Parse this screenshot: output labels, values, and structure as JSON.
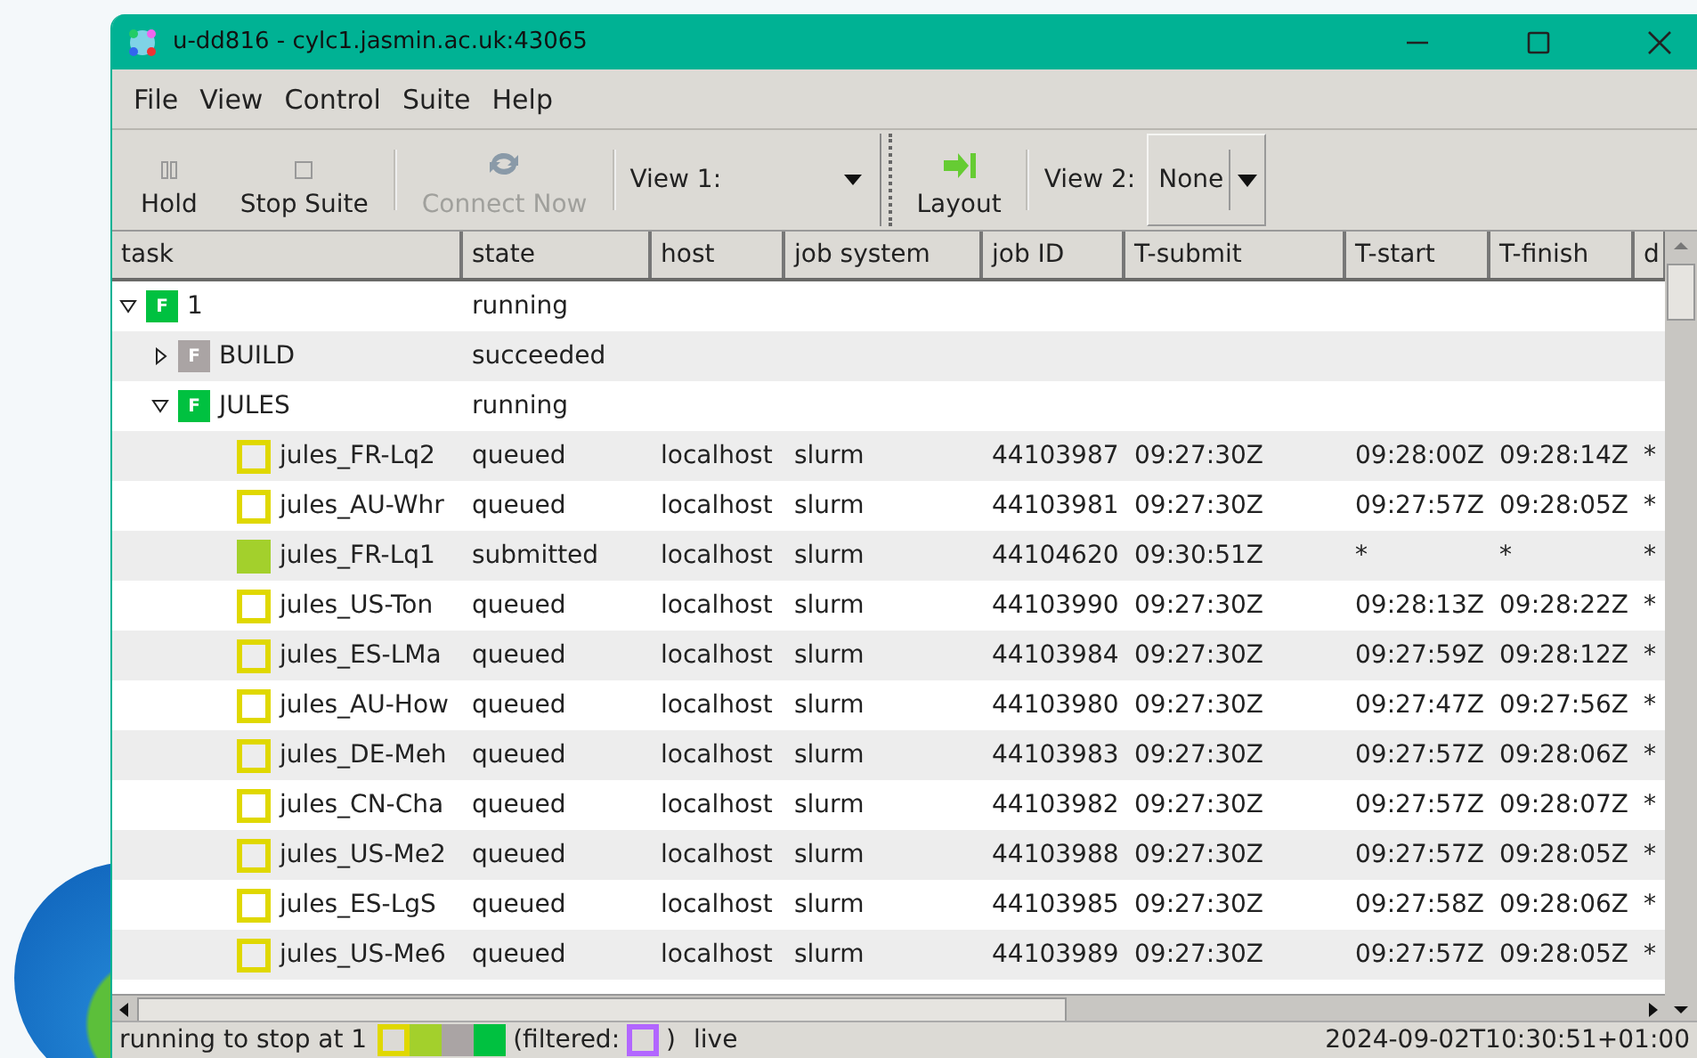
{
  "window": {
    "title": "u-dd816 - cylc1.jasmin.ac.uk:43065"
  },
  "menu": [
    "File",
    "View",
    "Control",
    "Suite",
    "Help"
  ],
  "toolbar": {
    "hold": "Hold",
    "stop": "Stop Suite",
    "connect": "Connect Now",
    "view1_label": "View 1:",
    "layout": "Layout",
    "view2_label": "View 2:",
    "view2_value": "None"
  },
  "table": {
    "columns": [
      "task",
      "state",
      "host",
      "job system",
      "job ID",
      "T-submit",
      "T-start",
      "T-finish",
      "d"
    ],
    "rows": [
      {
        "kind": "family",
        "badge": "F",
        "color": "#00c140",
        "expanded": true,
        "cells": [
          "1",
          "running",
          "",
          "",
          "",
          "",
          "",
          "",
          ""
        ],
        "children": [
          {
            "kind": "family",
            "badge": "F",
            "color": "#aaa4a4",
            "expanded": false,
            "cells": [
              "BUILD",
              "succeeded",
              "",
              "",
              "",
              "",
              "",
              "",
              ""
            ]
          },
          {
            "kind": "family",
            "badge": "F",
            "color": "#00c140",
            "expanded": true,
            "cells": [
              "JULES",
              "running",
              "",
              "",
              "",
              "",
              "",
              "",
              ""
            ],
            "children": [
              {
                "kind": "task",
                "color": "#e0d800",
                "filled": false,
                "cells": [
                  "jules_FR-Lq2",
                  "queued",
                  "localhost",
                  "slurm",
                  "44103987",
                  "09:27:30Z",
                  "09:28:00Z",
                  "09:28:14Z",
                  "*"
                ]
              },
              {
                "kind": "task",
                "color": "#e0d800",
                "filled": false,
                "cells": [
                  "jules_AU-Whr",
                  "queued",
                  "localhost",
                  "slurm",
                  "44103981",
                  "09:27:30Z",
                  "09:27:57Z",
                  "09:28:05Z",
                  "*"
                ]
              },
              {
                "kind": "task",
                "color": "#a3d02c",
                "filled": true,
                "cells": [
                  "jules_FR-Lq1",
                  "submitted",
                  "localhost",
                  "slurm",
                  "44104620",
                  "09:30:51Z",
                  "*",
                  "*",
                  "*"
                ]
              },
              {
                "kind": "task",
                "color": "#e0d800",
                "filled": false,
                "cells": [
                  "jules_US-Ton",
                  "queued",
                  "localhost",
                  "slurm",
                  "44103990",
                  "09:27:30Z",
                  "09:28:13Z",
                  "09:28:22Z",
                  "*"
                ]
              },
              {
                "kind": "task",
                "color": "#e0d800",
                "filled": false,
                "cells": [
                  "jules_ES-LMa",
                  "queued",
                  "localhost",
                  "slurm",
                  "44103984",
                  "09:27:30Z",
                  "09:27:59Z",
                  "09:28:12Z",
                  "*"
                ]
              },
              {
                "kind": "task",
                "color": "#e0d800",
                "filled": false,
                "cells": [
                  "jules_AU-How",
                  "queued",
                  "localhost",
                  "slurm",
                  "44103980",
                  "09:27:30Z",
                  "09:27:47Z",
                  "09:27:56Z",
                  "*"
                ]
              },
              {
                "kind": "task",
                "color": "#e0d800",
                "filled": false,
                "cells": [
                  "jules_DE-Meh",
                  "queued",
                  "localhost",
                  "slurm",
                  "44103983",
                  "09:27:30Z",
                  "09:27:57Z",
                  "09:28:06Z",
                  "*"
                ]
              },
              {
                "kind": "task",
                "color": "#e0d800",
                "filled": false,
                "cells": [
                  "jules_CN-Cha",
                  "queued",
                  "localhost",
                  "slurm",
                  "44103982",
                  "09:27:30Z",
                  "09:27:57Z",
                  "09:28:07Z",
                  "*"
                ]
              },
              {
                "kind": "task",
                "color": "#e0d800",
                "filled": false,
                "cells": [
                  "jules_US-Me2",
                  "queued",
                  "localhost",
                  "slurm",
                  "44103988",
                  "09:27:30Z",
                  "09:27:57Z",
                  "09:28:05Z",
                  "*"
                ]
              },
              {
                "kind": "task",
                "color": "#e0d800",
                "filled": false,
                "cells": [
                  "jules_ES-LgS",
                  "queued",
                  "localhost",
                  "slurm",
                  "44103985",
                  "09:27:30Z",
                  "09:27:58Z",
                  "09:28:06Z",
                  "*"
                ]
              },
              {
                "kind": "task",
                "color": "#e0d800",
                "filled": false,
                "cells": [
                  "jules_US-Me6",
                  "queued",
                  "localhost",
                  "slurm",
                  "44103989",
                  "09:27:30Z",
                  "09:27:57Z",
                  "09:28:05Z",
                  "*"
                ]
              }
            ]
          }
        ]
      }
    ]
  },
  "status_bar": {
    "text": "running to stop at 1",
    "legend": [
      {
        "color": "#e0d800",
        "filled": false
      },
      {
        "color": "#a3d02c",
        "filled": true
      },
      {
        "color": "#aaa4a4",
        "filled": true
      },
      {
        "color": "#00c140",
        "filled": true
      }
    ],
    "filtered_label": "(filtered:",
    "close_paren": ")",
    "mode": "live",
    "time": "2024-09-02T10:30:51+01:00"
  }
}
